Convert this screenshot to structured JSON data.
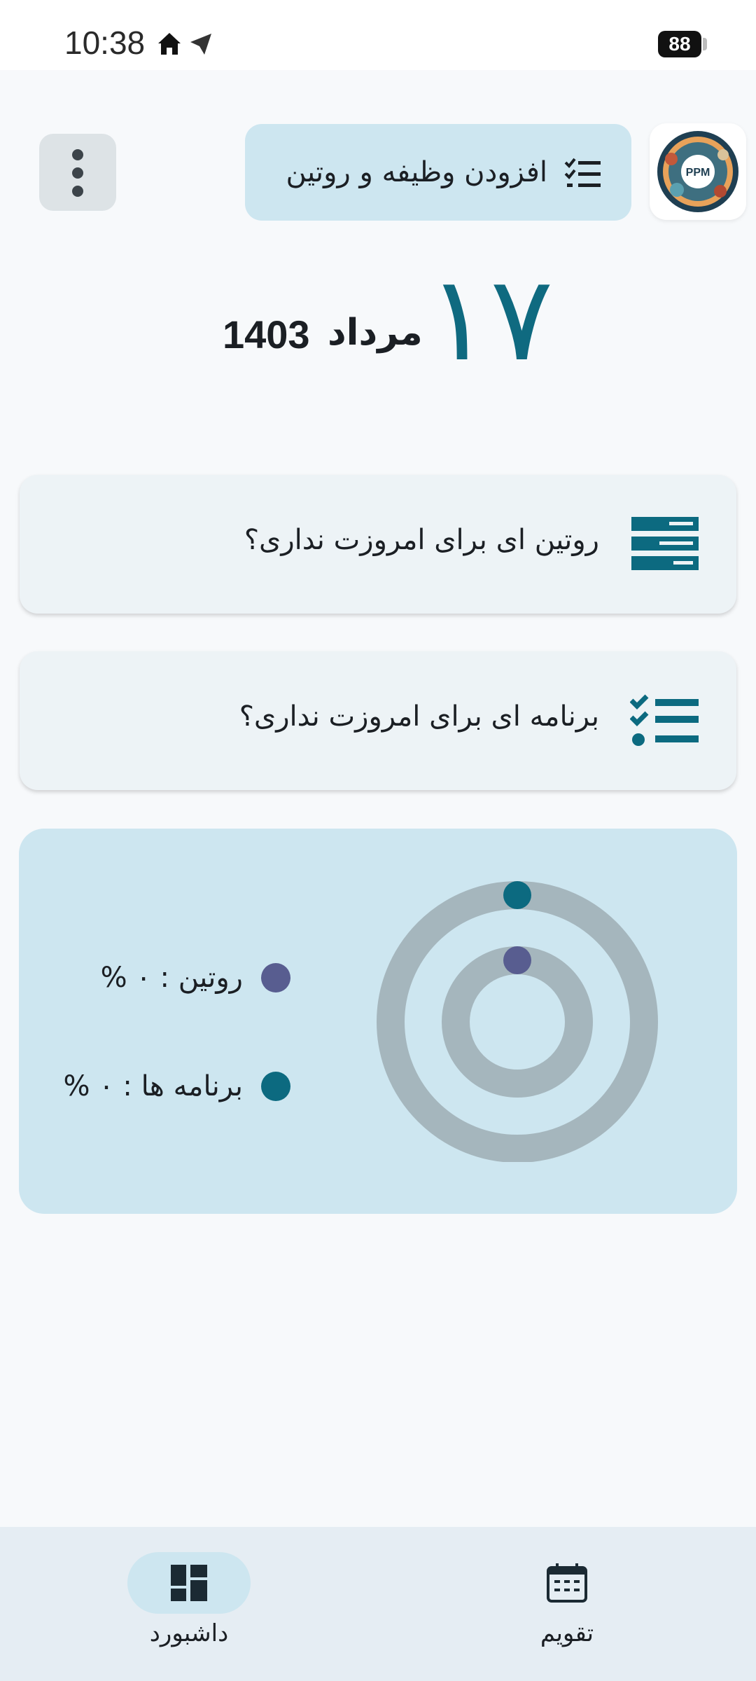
{
  "status_bar": {
    "time": "10:38",
    "battery": "88"
  },
  "header": {
    "add_button_label": "افزودن وظیفه و روتین",
    "logo_text": "PPM"
  },
  "date": {
    "day": "۱۷",
    "month": "مرداد",
    "year": "1403"
  },
  "cards": [
    {
      "text": "روتین ای برای امروزت نداری؟",
      "icon": "routine-list-icon"
    },
    {
      "text": "برنامه ای برای امروزت نداری؟",
      "icon": "checklist-icon"
    }
  ],
  "progress": {
    "legend": [
      {
        "label": "روتین : ۰ %",
        "color": "#585d90"
      },
      {
        "label": "برنامه ها : ۰ %",
        "color": "#0c6a80"
      }
    ],
    "routine_percent": 0,
    "programs_percent": 0,
    "track_color": "#a5b6bd"
  },
  "bottom_nav": {
    "items": [
      {
        "label": "داشبورد",
        "icon": "dashboard-icon",
        "active": true
      },
      {
        "label": "تقویم",
        "icon": "calendar-icon",
        "active": false
      }
    ]
  },
  "colors": {
    "accent": "#0c6a80",
    "secondary": "#585d90",
    "panel": "#cde6f0"
  }
}
